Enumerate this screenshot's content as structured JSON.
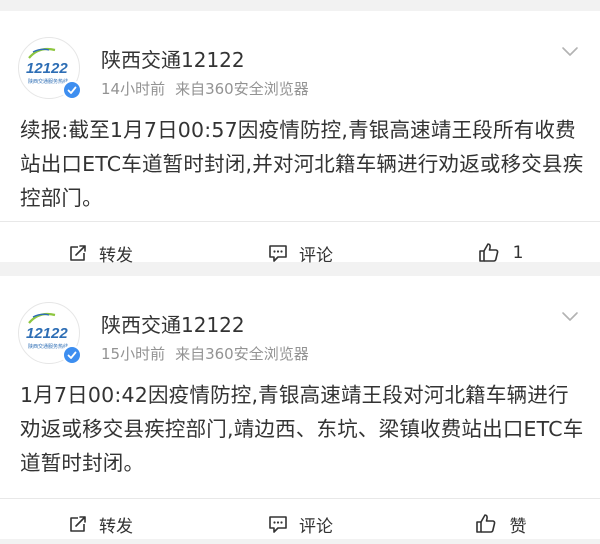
{
  "posts": [
    {
      "account_name": "陕西交通12122",
      "avatar_caption": "陕西交通服务热线",
      "avatar_number": "12122",
      "time": "14小时前",
      "source": "来自360安全浏览器",
      "text": "续报:截至1月7日00:57因疫情防控,青银高速靖王段所有收费站出口ETC车道暂时封闭,并对河北籍车辆进行劝返或移交县疾控部门。",
      "actions": {
        "repost": "转发",
        "comment": "评论",
        "like": "1"
      }
    },
    {
      "account_name": "陕西交通12122",
      "avatar_caption": "陕西交通服务热线",
      "avatar_number": "12122",
      "time": "15小时前",
      "source": "来自360安全浏览器",
      "text": "1月7日00:42因疫情防控,青银高速靖王段对河北籍车辆进行劝返或移交县疾控部门,靖边西、东坑、梁镇收费站出口ETC车道暂时封闭。",
      "actions": {
        "repost": "转发",
        "comment": "评论",
        "like": "赞"
      }
    }
  ],
  "colors": {
    "background": "#f2f2f2",
    "card": "#ffffff",
    "text": "#333333",
    "meta": "#939393",
    "verified": "#3d8ef0",
    "logo_green": "#8dc63f",
    "logo_blue": "#2e6eb5"
  },
  "icons": [
    "avatar-logo-icon",
    "verified-badge-icon",
    "chevron-down-icon",
    "repost-icon",
    "comment-icon",
    "like-icon"
  ]
}
